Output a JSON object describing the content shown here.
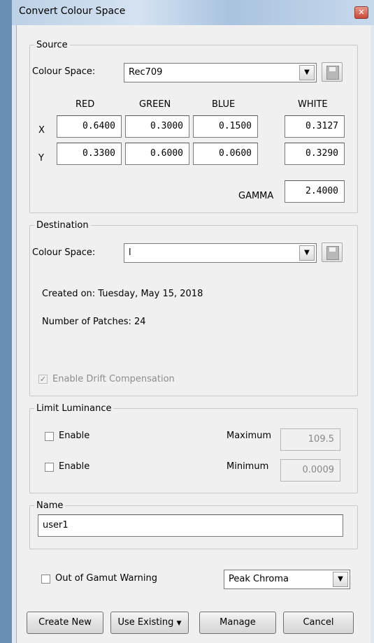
{
  "window": {
    "title": "Convert Colour Space"
  },
  "source": {
    "legend": "Source",
    "colour_space_label": "Colour Space:",
    "colour_space_value": "Rec709",
    "headers": [
      "RED",
      "GREEN",
      "BLUE",
      "WHITE"
    ],
    "rows": [
      {
        "label": "X",
        "values": [
          "0.6400",
          "0.3000",
          "0.1500",
          "0.3127"
        ]
      },
      {
        "label": "Y",
        "values": [
          "0.3300",
          "0.6000",
          "0.0600",
          "0.3290"
        ]
      }
    ],
    "gamma_label": "GAMMA",
    "gamma_value": "2.4000"
  },
  "destination": {
    "legend": "Destination",
    "colour_space_label": "Colour Space:",
    "colour_space_value": "l",
    "created_on": "Created on: Tuesday, May 15, 2018",
    "patches": "Number of Patches: 24",
    "drift_label": "Enable Drift Compensation"
  },
  "limit": {
    "legend": "Limit Luminance",
    "enable_max_label": "Enable",
    "enable_min_label": "Enable",
    "max_label": "Maximum",
    "max_value": "109.5",
    "min_label": "Minimum",
    "min_value": "0.0009"
  },
  "name": {
    "legend": "Name",
    "value": "user1"
  },
  "gamut": {
    "label": "Out of Gamut Warning",
    "mode": "Peak Chroma"
  },
  "buttons": {
    "create": "Create New",
    "use_existing": "Use Existing",
    "manage": "Manage",
    "cancel": "Cancel"
  }
}
